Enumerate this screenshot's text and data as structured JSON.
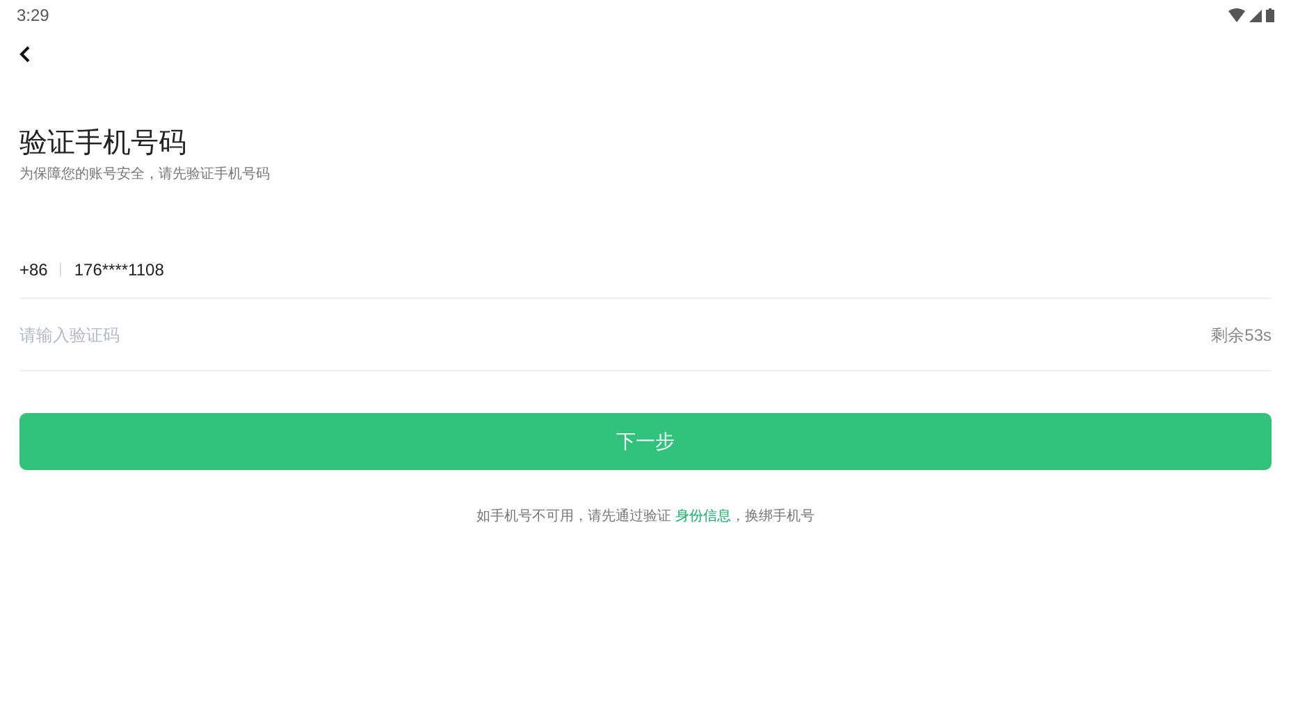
{
  "status_bar": {
    "time": "3:29"
  },
  "title": "验证手机号码",
  "subtitle": "为保障您的账号安全，请先验证手机号码",
  "phone": {
    "country_code": "+86",
    "number": "176****1108"
  },
  "code_field": {
    "placeholder": "请输入验证码",
    "countdown": "剩余53s"
  },
  "next_button": "下一步",
  "footer": {
    "before": "如手机号不可用，请先通过验证 ",
    "link": "身份信息",
    "after": "，换绑手机号"
  }
}
